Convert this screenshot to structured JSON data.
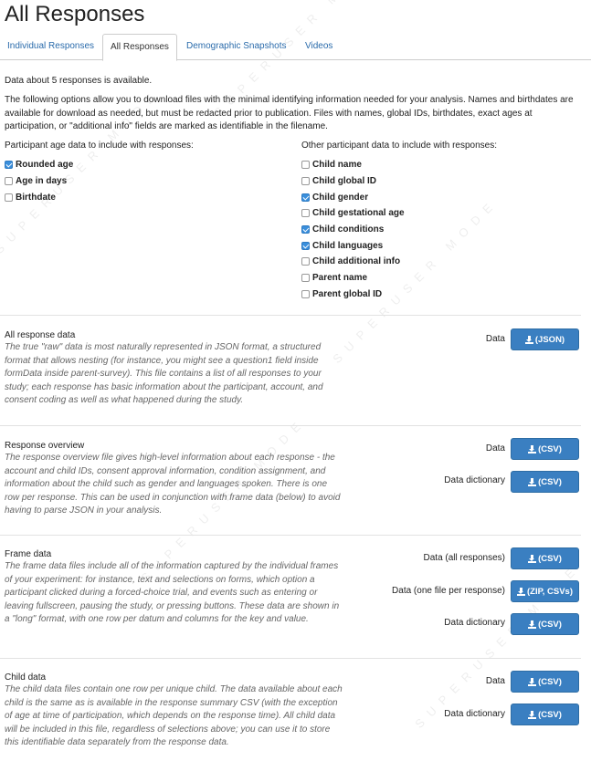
{
  "page": {
    "title": "All Responses"
  },
  "tabs": [
    {
      "label": "Individual Responses"
    },
    {
      "label": "All Responses"
    },
    {
      "label": "Demographic Snapshots"
    },
    {
      "label": "Videos"
    }
  ],
  "intro": {
    "count_text": "Data about 5 responses is available.",
    "description": "The following options allow you to download files with the minimal identifying information needed for your analysis. Names and birthdates are available for download as needed, but must be redacted prior to publication. Files with names, global IDs, birthdates, exact ages at participation, or \"additional info\" fields are marked as identifiable in the filename."
  },
  "age_options": {
    "heading": "Participant age data to include with responses:",
    "items": [
      {
        "label": "Rounded age",
        "checked": true
      },
      {
        "label": "Age in days",
        "checked": false
      },
      {
        "label": "Birthdate",
        "checked": false
      }
    ]
  },
  "other_options": {
    "heading": "Other participant data to include with responses:",
    "items": [
      {
        "label": "Child name",
        "checked": false
      },
      {
        "label": "Child global ID",
        "checked": false
      },
      {
        "label": "Child gender",
        "checked": true
      },
      {
        "label": "Child gestational age",
        "checked": false
      },
      {
        "label": "Child conditions",
        "checked": true
      },
      {
        "label": "Child languages",
        "checked": true
      },
      {
        "label": "Child additional info",
        "checked": false
      },
      {
        "label": "Parent name",
        "checked": false
      },
      {
        "label": "Parent global ID",
        "checked": false
      }
    ]
  },
  "sections": [
    {
      "title": "All response data",
      "description": "The true \"raw\" data is most naturally represented in JSON format, a structured format that allows nesting (for instance, you might see a question1 field inside formData inside parent-survey). This file contains a list of all responses to your study; each response has basic information about the participant, account, and consent coding as well as what happened during the study.",
      "downloads": [
        {
          "label": "Data",
          "button": "(JSON)"
        }
      ]
    },
    {
      "title": "Response overview",
      "description": "The response overview file gives high-level information about each response - the account and child IDs, consent approval information, condition assignment, and information about the child such as gender and languages spoken. There is one row per response. This can be used in conjunction with frame data (below) to avoid having to parse JSON in your analysis.",
      "downloads": [
        {
          "label": "Data",
          "button": "(CSV)"
        },
        {
          "label": "Data dictionary",
          "button": "(CSV)"
        }
      ]
    },
    {
      "title": "Frame data",
      "description": "The frame data files include all of the information captured by the individual frames of your experiment: for instance, text and selections on forms, which option a participant clicked during a forced-choice trial, and events such as entering or leaving fullscreen, pausing the study, or pressing buttons. These data are shown in a \"long\" format, with one row per datum and columns for the key and value.",
      "downloads": [
        {
          "label": "Data (all responses)",
          "button": "(CSV)"
        },
        {
          "label": "Data (one file per response)",
          "button": "(ZIP, CSVs)"
        },
        {
          "label": "Data dictionary",
          "button": "(CSV)"
        }
      ]
    },
    {
      "title": "Child data",
      "description": "The child data files contain one row per unique child. The data available about each child is the same as is available in the response summary CSV (with the exception of age at time of participation, which depends on the response time). All child data will be included in this file, regardless of selections above; you can use it to store this identifiable data separately from the response data.",
      "downloads": [
        {
          "label": "Data",
          "button": "(CSV)"
        },
        {
          "label": "Data dictionary",
          "button": "(CSV)"
        }
      ]
    }
  ],
  "watermark": {
    "text": "SUPERUSER MODE"
  },
  "colors": {
    "link": "#2a6bab",
    "button": "#3a7fc1",
    "checkbox": "#3a8fdc"
  },
  "icons": {
    "download": "download-icon",
    "checkbox_checked": "checkbox-checked-icon"
  }
}
